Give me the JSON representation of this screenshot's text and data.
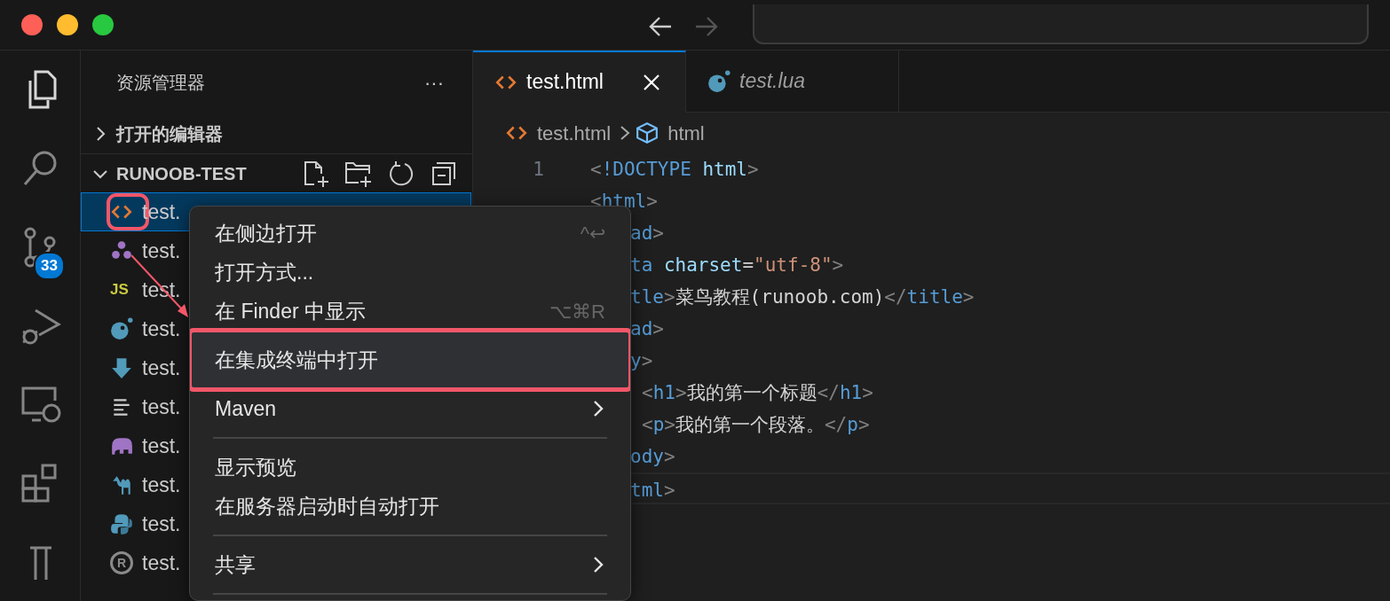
{
  "title_bar": {
    "back_enabled": true,
    "forward_enabled": false
  },
  "activity_bar": [
    {
      "kind": "files",
      "selected": true
    },
    {
      "kind": "search",
      "selected": false
    },
    {
      "kind": "source-control",
      "selected": false,
      "badge": "33"
    },
    {
      "kind": "run-debug",
      "selected": false
    },
    {
      "kind": "remote",
      "selected": false
    },
    {
      "kind": "extensions",
      "selected": false
    },
    {
      "kind": "testing",
      "selected": false
    }
  ],
  "sidebar": {
    "title": "资源管理器",
    "more": "···",
    "sections": [
      {
        "label": "打开的编辑器",
        "expanded": false
      },
      {
        "label": "RUNOOB-TEST",
        "expanded": true
      }
    ],
    "files": [
      {
        "name": "test.",
        "kind": "html",
        "selected": true,
        "highlighted": true
      },
      {
        "name": "test.",
        "kind": "dots",
        "selected": false,
        "highlighted": false
      },
      {
        "name": "test.",
        "kind": "js",
        "icon_text": "JS",
        "selected": false,
        "highlighted": false
      },
      {
        "name": "test.",
        "kind": "lua",
        "selected": false,
        "highlighted": false
      },
      {
        "name": "test.",
        "kind": "down",
        "selected": false,
        "highlighted": false
      },
      {
        "name": "test.",
        "kind": "lines",
        "selected": false,
        "highlighted": false
      },
      {
        "name": "test.",
        "kind": "elephant",
        "selected": false,
        "highlighted": false
      },
      {
        "name": "test.",
        "kind": "camel",
        "selected": false,
        "highlighted": false
      },
      {
        "name": "test.",
        "kind": "python",
        "selected": false,
        "highlighted": false
      },
      {
        "name": "test.",
        "kind": "r",
        "icon_text": "R",
        "selected": false,
        "highlighted": false
      }
    ]
  },
  "tabs": [
    {
      "label": "test.html",
      "kind": "html",
      "selected": true,
      "preview": false
    },
    {
      "label": "test.lua",
      "kind": "lua",
      "selected": false,
      "preview": true
    }
  ],
  "breadcrumbs": [
    {
      "label": "test.html",
      "kind": "html"
    },
    {
      "label": "html",
      "kind": "cube"
    }
  ],
  "editor": {
    "line_numbers": [
      "1"
    ],
    "lines": [
      {
        "kind": "full",
        "current": false,
        "tokens": [
          {
            "text": "<",
            "kind": "punct"
          },
          {
            "text": "!DOCTYPE",
            "kind": "tag"
          },
          {
            "text": "html",
            "kind": "attr",
            "gap_before": true
          },
          {
            "text": ">",
            "kind": "punct"
          }
        ]
      },
      {
        "kind": "full",
        "current": false,
        "tokens": [
          {
            "text": "<",
            "kind": "punct"
          },
          {
            "text": "html",
            "kind": "tag"
          },
          {
            "text": ">",
            "kind": "punct"
          }
        ]
      },
      {
        "kind": "clipped",
        "current": false,
        "tokens": [
          {
            "text": "ad",
            "kind": "tag"
          },
          {
            "text": ">",
            "kind": "punct"
          }
        ]
      },
      {
        "kind": "clipped",
        "current": false,
        "tokens": [
          {
            "text": "ta",
            "kind": "tag"
          },
          {
            "text": "charset",
            "kind": "attr",
            "gap_before": true
          },
          {
            "text": "=",
            "kind": "plain"
          },
          {
            "text": "\"utf-8\"",
            "kind": "string"
          },
          {
            "text": ">",
            "kind": "punct"
          }
        ]
      },
      {
        "kind": "clipped",
        "current": false,
        "tokens": [
          {
            "text": "tle",
            "kind": "tag"
          },
          {
            "text": ">",
            "kind": "punct"
          },
          {
            "text": "菜鸟教程(runoob.com)",
            "kind": "plain"
          },
          {
            "text": "</",
            "kind": "punct"
          },
          {
            "text": "title",
            "kind": "tag"
          },
          {
            "text": ">",
            "kind": "punct"
          }
        ]
      },
      {
        "kind": "clipped",
        "current": false,
        "tokens": [
          {
            "text": "ad",
            "kind": "tag"
          },
          {
            "text": ">",
            "kind": "punct"
          }
        ]
      },
      {
        "kind": "clipped",
        "current": false,
        "tokens": [
          {
            "text": "y",
            "kind": "tag"
          },
          {
            "text": ">",
            "kind": "punct"
          }
        ]
      },
      {
        "kind": "clipped-indent",
        "current": false,
        "tokens": [
          {
            "text": "<",
            "kind": "punct"
          },
          {
            "text": "h1",
            "kind": "tag"
          },
          {
            "text": ">",
            "kind": "punct"
          },
          {
            "text": "我的第一个标题",
            "kind": "plain"
          },
          {
            "text": "</",
            "kind": "punct"
          },
          {
            "text": "h1",
            "kind": "tag"
          },
          {
            "text": ">",
            "kind": "punct"
          }
        ]
      },
      {
        "kind": "clipped-indent",
        "current": false,
        "tokens": [
          {
            "text": "<",
            "kind": "punct"
          },
          {
            "text": "p",
            "kind": "tag"
          },
          {
            "text": ">",
            "kind": "punct"
          },
          {
            "text": "我的第一个段落。",
            "kind": "plain"
          },
          {
            "text": "</",
            "kind": "punct"
          },
          {
            "text": "p",
            "kind": "tag"
          },
          {
            "text": ">",
            "kind": "punct"
          }
        ]
      },
      {
        "kind": "clipped",
        "current": false,
        "tokens": [
          {
            "text": "ody",
            "kind": "tag"
          },
          {
            "text": ">",
            "kind": "punct"
          }
        ]
      },
      {
        "kind": "clipped",
        "current": true,
        "tokens": [
          {
            "text": "tml",
            "kind": "tag"
          },
          {
            "text": ">",
            "kind": "punct"
          }
        ]
      }
    ]
  },
  "context_menu": [
    {
      "kind": "item",
      "label": "在侧边打开",
      "shortcut": "^↩",
      "submenu": false,
      "hovered": false,
      "highlighted": false
    },
    {
      "kind": "item",
      "label": "打开方式...",
      "submenu": false,
      "hovered": false,
      "highlighted": false
    },
    {
      "kind": "item",
      "label": "在 Finder 中显示",
      "shortcut": "⌥⌘R",
      "submenu": false,
      "hovered": false,
      "highlighted": false
    },
    {
      "kind": "item",
      "label": "在集成终端中打开",
      "submenu": false,
      "hovered": true,
      "highlighted": true
    },
    {
      "kind": "item",
      "label": "Maven",
      "submenu": true,
      "hovered": false,
      "highlighted": false
    },
    {
      "kind": "separator"
    },
    {
      "kind": "item",
      "label": "显示预览",
      "submenu": false,
      "hovered": false,
      "highlighted": false
    },
    {
      "kind": "item",
      "label": "在服务器启动时自动打开",
      "submenu": false,
      "hovered": false,
      "highlighted": false
    },
    {
      "kind": "separator"
    },
    {
      "kind": "item",
      "label": "共享",
      "submenu": true,
      "hovered": false,
      "highlighted": false
    },
    {
      "kind": "separator"
    }
  ],
  "annotations": [
    {
      "kind": "arrow"
    }
  ]
}
